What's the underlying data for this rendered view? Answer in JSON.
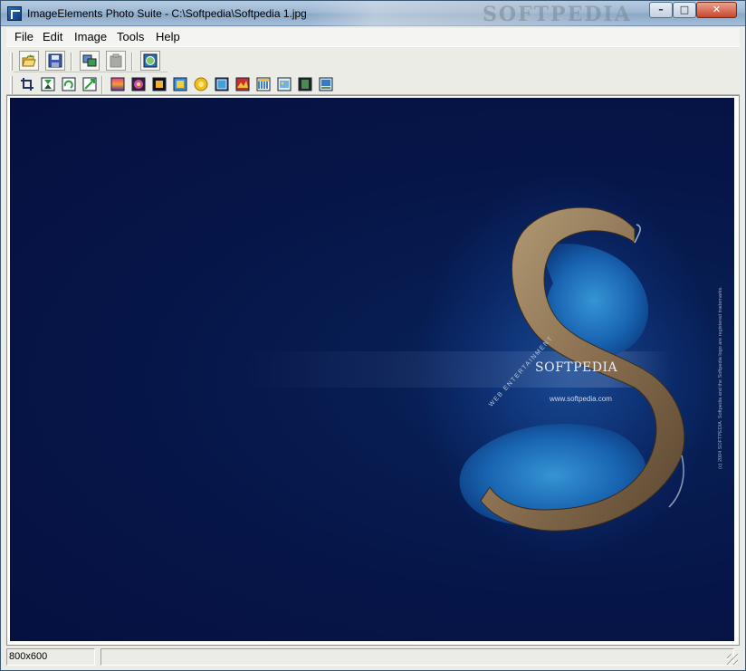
{
  "window": {
    "title": "ImageElements Photo Suite - C:\\Softpedia\\Softpedia 1.jpg",
    "title_watermark": "SOFTPEDIA",
    "controls": {
      "minimize": "–",
      "maximize": "□",
      "close": "✕"
    }
  },
  "menu": {
    "items": [
      {
        "label": "File"
      },
      {
        "label": "Edit"
      },
      {
        "label": "Image"
      },
      {
        "label": "Tools"
      },
      {
        "label": "Help"
      }
    ]
  },
  "toolbar": {
    "row1": [
      {
        "icon": "open-folder-icon"
      },
      {
        "icon": "save-disk-icon"
      },
      {
        "icon": "copy-image-icon"
      },
      {
        "icon": "paste-image-icon-disabled"
      },
      {
        "icon": "web-export-icon"
      }
    ],
    "row2": [
      {
        "icon": "crop-icon"
      },
      {
        "icon": "flip-vertical-icon"
      },
      {
        "icon": "rotate-icon"
      },
      {
        "icon": "rotate-free-icon"
      },
      {
        "icon": "gradient-effect-icon"
      },
      {
        "icon": "flower-effect-icon"
      },
      {
        "icon": "frame-effect-icon"
      },
      {
        "icon": "blur-effect-icon"
      },
      {
        "icon": "sun-effect-icon"
      },
      {
        "icon": "border-effect-icon"
      },
      {
        "icon": "paint-effect-icon"
      },
      {
        "icon": "water-effect-icon"
      },
      {
        "icon": "picture-effect-icon"
      },
      {
        "icon": "film-frame-icon"
      },
      {
        "icon": "thumbnail-icon"
      }
    ]
  },
  "canvas": {
    "brand": "SOFTPEDIA",
    "url": "www.softpedia.com",
    "tagline": "WEB ENTERTAINMENT",
    "copyright": "(c) 2004 SOFTPEDIA. Softpedia and the Softpedia logo are registered trademarks.",
    "background_color": "#061548",
    "accent_color": "#2a6fd0"
  },
  "status": {
    "image_size": "800x600",
    "info": ""
  }
}
